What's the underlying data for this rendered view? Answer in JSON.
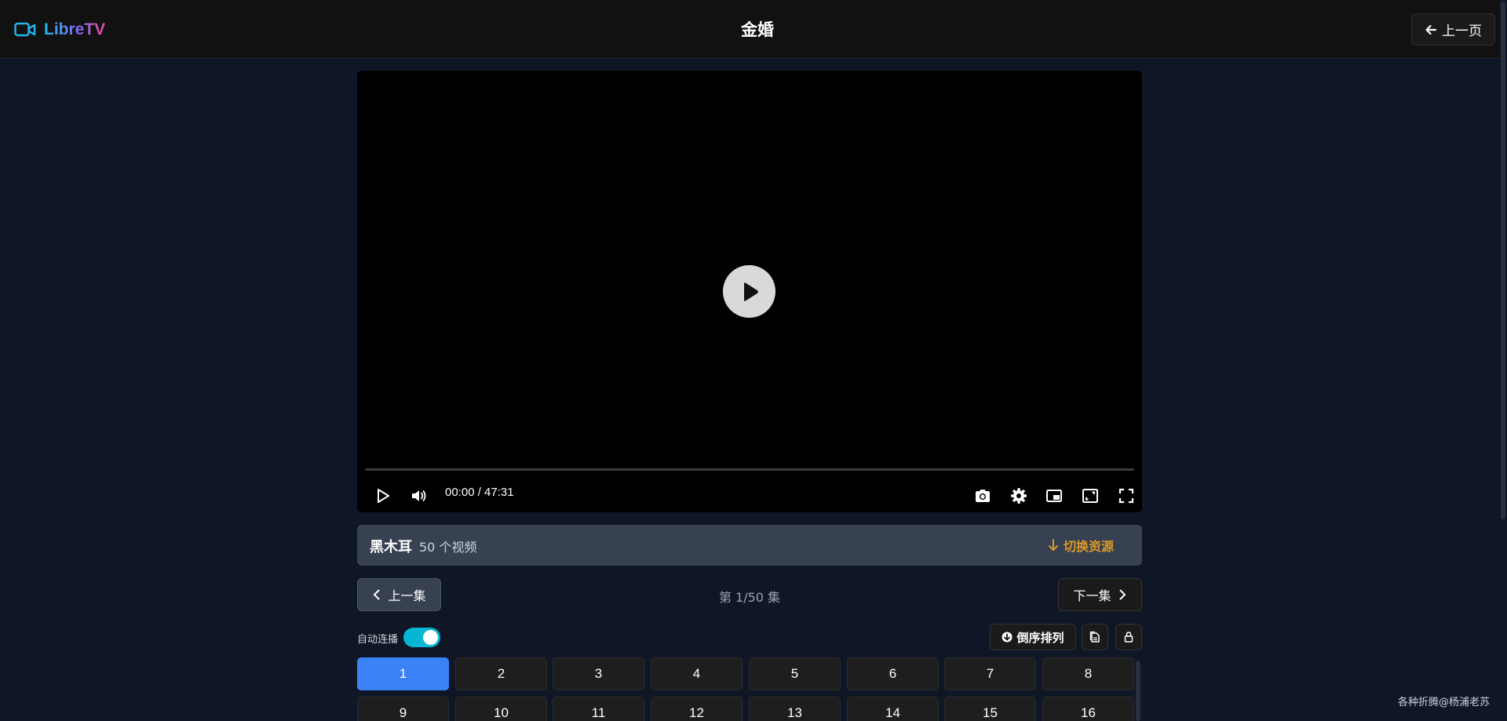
{
  "header": {
    "logo_text": "LibreTV",
    "title": "金婚",
    "back_label": "上一页"
  },
  "player": {
    "time_display": "00:00 / 47:31",
    "progress": 0,
    "controls": [
      "play-icon",
      "volume-icon",
      "camera-icon",
      "gear-icon",
      "picture-in-picture-icon",
      "web-fullscreen-icon",
      "fullscreen-icon"
    ]
  },
  "source": {
    "name": "黑木耳",
    "count": "50 个视频",
    "switch_label": "切换资源"
  },
  "episode_nav": {
    "prev_label": "上一集",
    "indicator": "第 1/50 集",
    "next_label": "下一集"
  },
  "options": {
    "autoplay_label": "自动连播",
    "autoplay_on": true,
    "order_label": "倒序排列"
  },
  "episodes": [
    "1",
    "2",
    "3",
    "4",
    "5",
    "6",
    "7",
    "8",
    "9",
    "10",
    "11",
    "12",
    "13",
    "14",
    "15",
    "16"
  ],
  "active_episode": "1",
  "footer": {
    "credit": "各种折腾@杨浦老苏"
  },
  "colors": {
    "accent": "#3b82f6",
    "toggle": "#06b6d4",
    "switch_source": "#d99a2b",
    "background": "#0f1625"
  }
}
